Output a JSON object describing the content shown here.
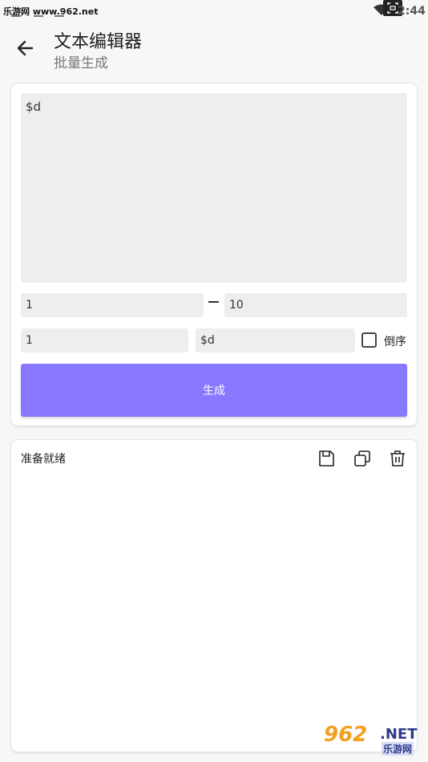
{
  "status_bar": {
    "watermark": "乐游网 www.962.net",
    "time": "2:44"
  },
  "header": {
    "title": "文本编辑器",
    "subtitle": "批量生成"
  },
  "form": {
    "template_value": "$d",
    "range_start": "1",
    "range_end": "10",
    "step": "1",
    "placeholder_token": "$d",
    "reverse_label": "倒序",
    "generate_label": "生成"
  },
  "output": {
    "status": "准备就绪"
  },
  "watermark": {
    "number": "962",
    "net": ".NET",
    "cn": "乐游网"
  },
  "colors": {
    "accent": "#8878ff"
  }
}
